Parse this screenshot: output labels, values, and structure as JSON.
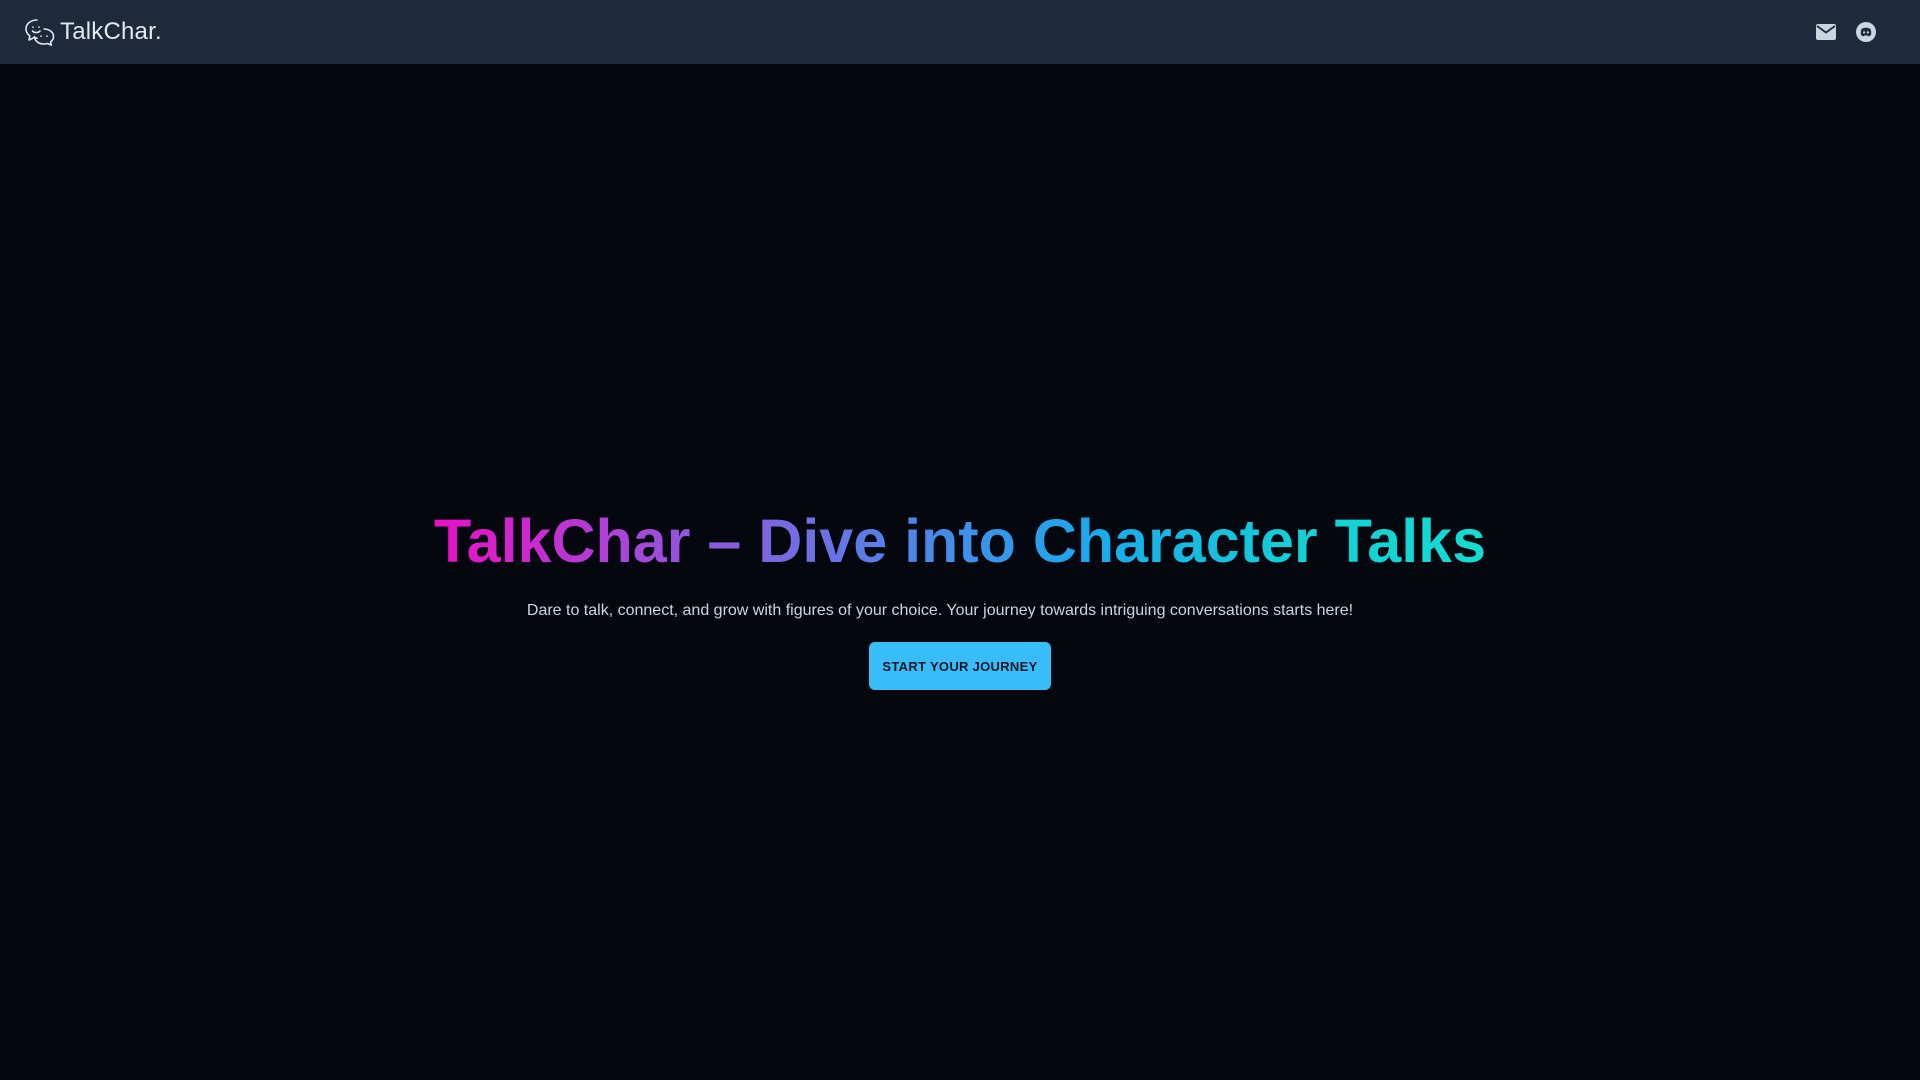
{
  "navbar": {
    "brand_name": "TalkChar.",
    "brand_icon": "chat-smiley-icon",
    "actions": [
      {
        "icon": "mail-icon"
      },
      {
        "icon": "discord-icon"
      }
    ]
  },
  "hero": {
    "title": "TalkChar – Dive into Character Talks",
    "subtitle": "Dare to talk, connect, and grow with figures of your choice. Your journey towards intriguing conversations starts here!",
    "cta_label": "START YOUR JOURNEY"
  },
  "colors": {
    "page_background": "#05070f",
    "navbar_background": "#1e293b",
    "cta_background": "#38bdf8",
    "title_gradient": [
      "#ec0fc6",
      "#9b4fdc",
      "#5a7ee6",
      "#1aa9ee",
      "#12dcd0"
    ]
  }
}
